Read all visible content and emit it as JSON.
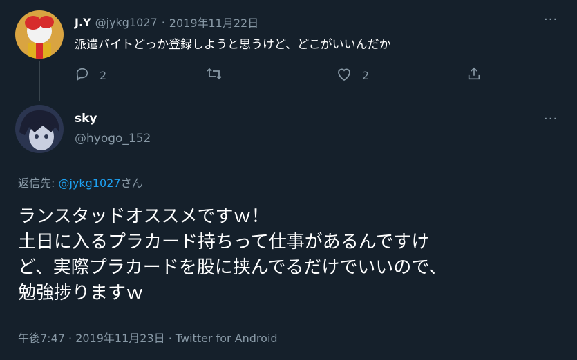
{
  "parent_tweet": {
    "display_name": "J.Y",
    "handle": "@jykg1027",
    "separator": "·",
    "date": "2019年11月22日",
    "text": "派遣バイトどっか登録しようと思うけど、どこがいいんだか",
    "reply_count": "2",
    "like_count": "2",
    "more_label": "···"
  },
  "main_tweet": {
    "display_name": "sky",
    "handle": "@hyogo_152",
    "more_label": "···",
    "reply_prefix": "返信先:",
    "reply_to": "@jykg1027",
    "reply_suffix": "さん",
    "lines": [
      "ランスタッドオススメですｗ！",
      "土日に入るプラカード持ちって仕事があるんですけ",
      "ど、実際プラカードを股に挟んでるだけでいいので、",
      "勉強捗りますｗ"
    ],
    "meta": "午後7:47 · 2019年11月23日 · Twitter for Android"
  },
  "colors": {
    "background": "#15202b",
    "muted": "#8899a6",
    "accent": "#1da1f2"
  }
}
